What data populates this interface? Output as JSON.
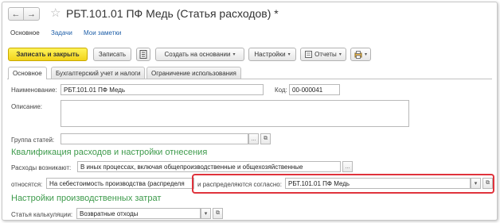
{
  "window": {
    "title": "РБТ.101.01 ПФ Медь (Статья расходов) *",
    "back_icon": "←",
    "forward_icon": "→",
    "favorite_icon": "☆"
  },
  "nav_links": [
    "Основное",
    "Задачи",
    "Мои заметки"
  ],
  "toolbar": {
    "save_close": "Записать и закрыть",
    "save": "Записать",
    "create_based": "Создать на основании",
    "settings": "Настройки",
    "reports": "Отчеты",
    "caret": "▾"
  },
  "tabs": [
    "Основное",
    "Бухгалтерский учет и налоги",
    "Ограничение использования"
  ],
  "form": {
    "name_label": "Наименование:",
    "name_value": "РБТ.101.01 ПФ Медь",
    "code_label": "Код:",
    "code_value": "00-000041",
    "description_label": "Описание:",
    "description_value": "",
    "group_label": "Группа статей:",
    "group_value": "",
    "section1_title": "Квалификация расходов и настройки отнесения",
    "costs_arise_label": "Расходы возникают:",
    "costs_arise_value": "В иных процессах, включая общепроизводственные и общехозяйственные",
    "relate_label": "относятся:",
    "relate_value": "На себестоимость производства (распределя",
    "distributed_label": "и распределяются согласно:",
    "distributed_value": "РБТ.101.01 ПФ Медь",
    "section2_title": "Настройки производственных затрат",
    "calc_label": "Статья калькуляции:",
    "calc_value": "Возвратные отходы",
    "ellipsis": "...",
    "open_icon": "⧉",
    "dropdown_icon": "▾"
  }
}
